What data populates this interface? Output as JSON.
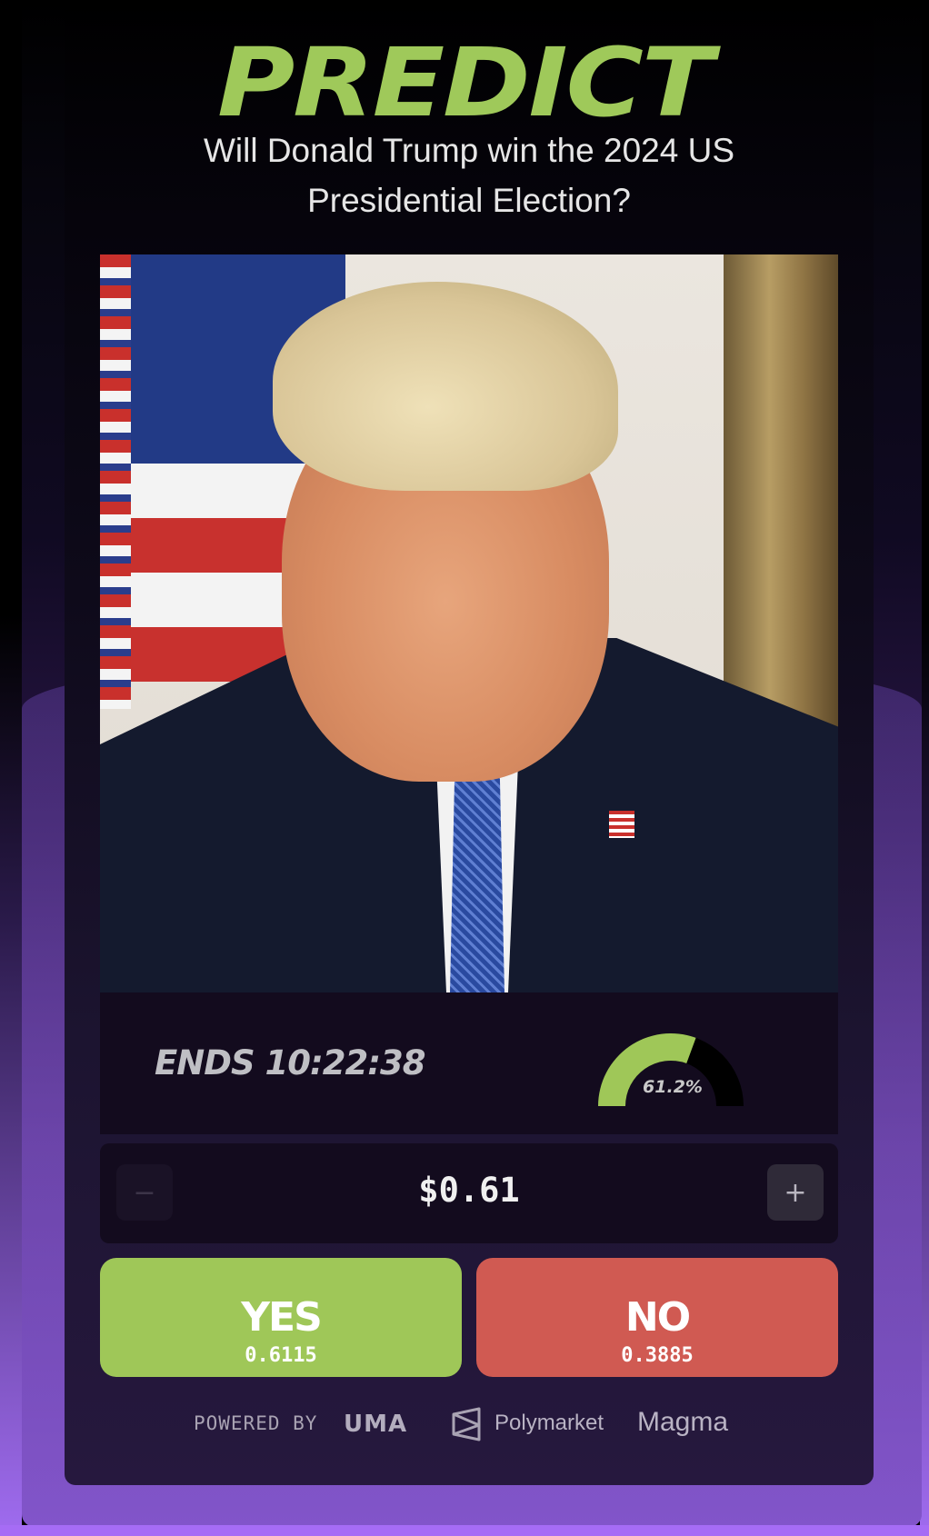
{
  "header": {
    "logo_text": "PREDICT",
    "question": "Will Donald Trump win the 2024 US Presidential Election?"
  },
  "market": {
    "portrait_alt": "Donald Trump",
    "ends_label": "ENDS 10:22:38",
    "probability_label": "61.2%",
    "probability_value": 0.612
  },
  "stepper": {
    "minus_symbol": "−",
    "plus_symbol": "+",
    "amount": "$0.61"
  },
  "actions": {
    "yes_label": "YES",
    "yes_odds": "0.6115",
    "no_label": "NO",
    "no_odds": "0.3885"
  },
  "footer": {
    "powered_by": "POWERED BY",
    "uma_logo_text": "UMA",
    "polymarket_text": "Polymarket",
    "magma_text": "Magma"
  },
  "colors": {
    "accent_green": "#9fc758",
    "no_red": "#d05a52",
    "gauge_track": "#000000"
  },
  "icons": {
    "polymarket": "polymarket-icon"
  }
}
